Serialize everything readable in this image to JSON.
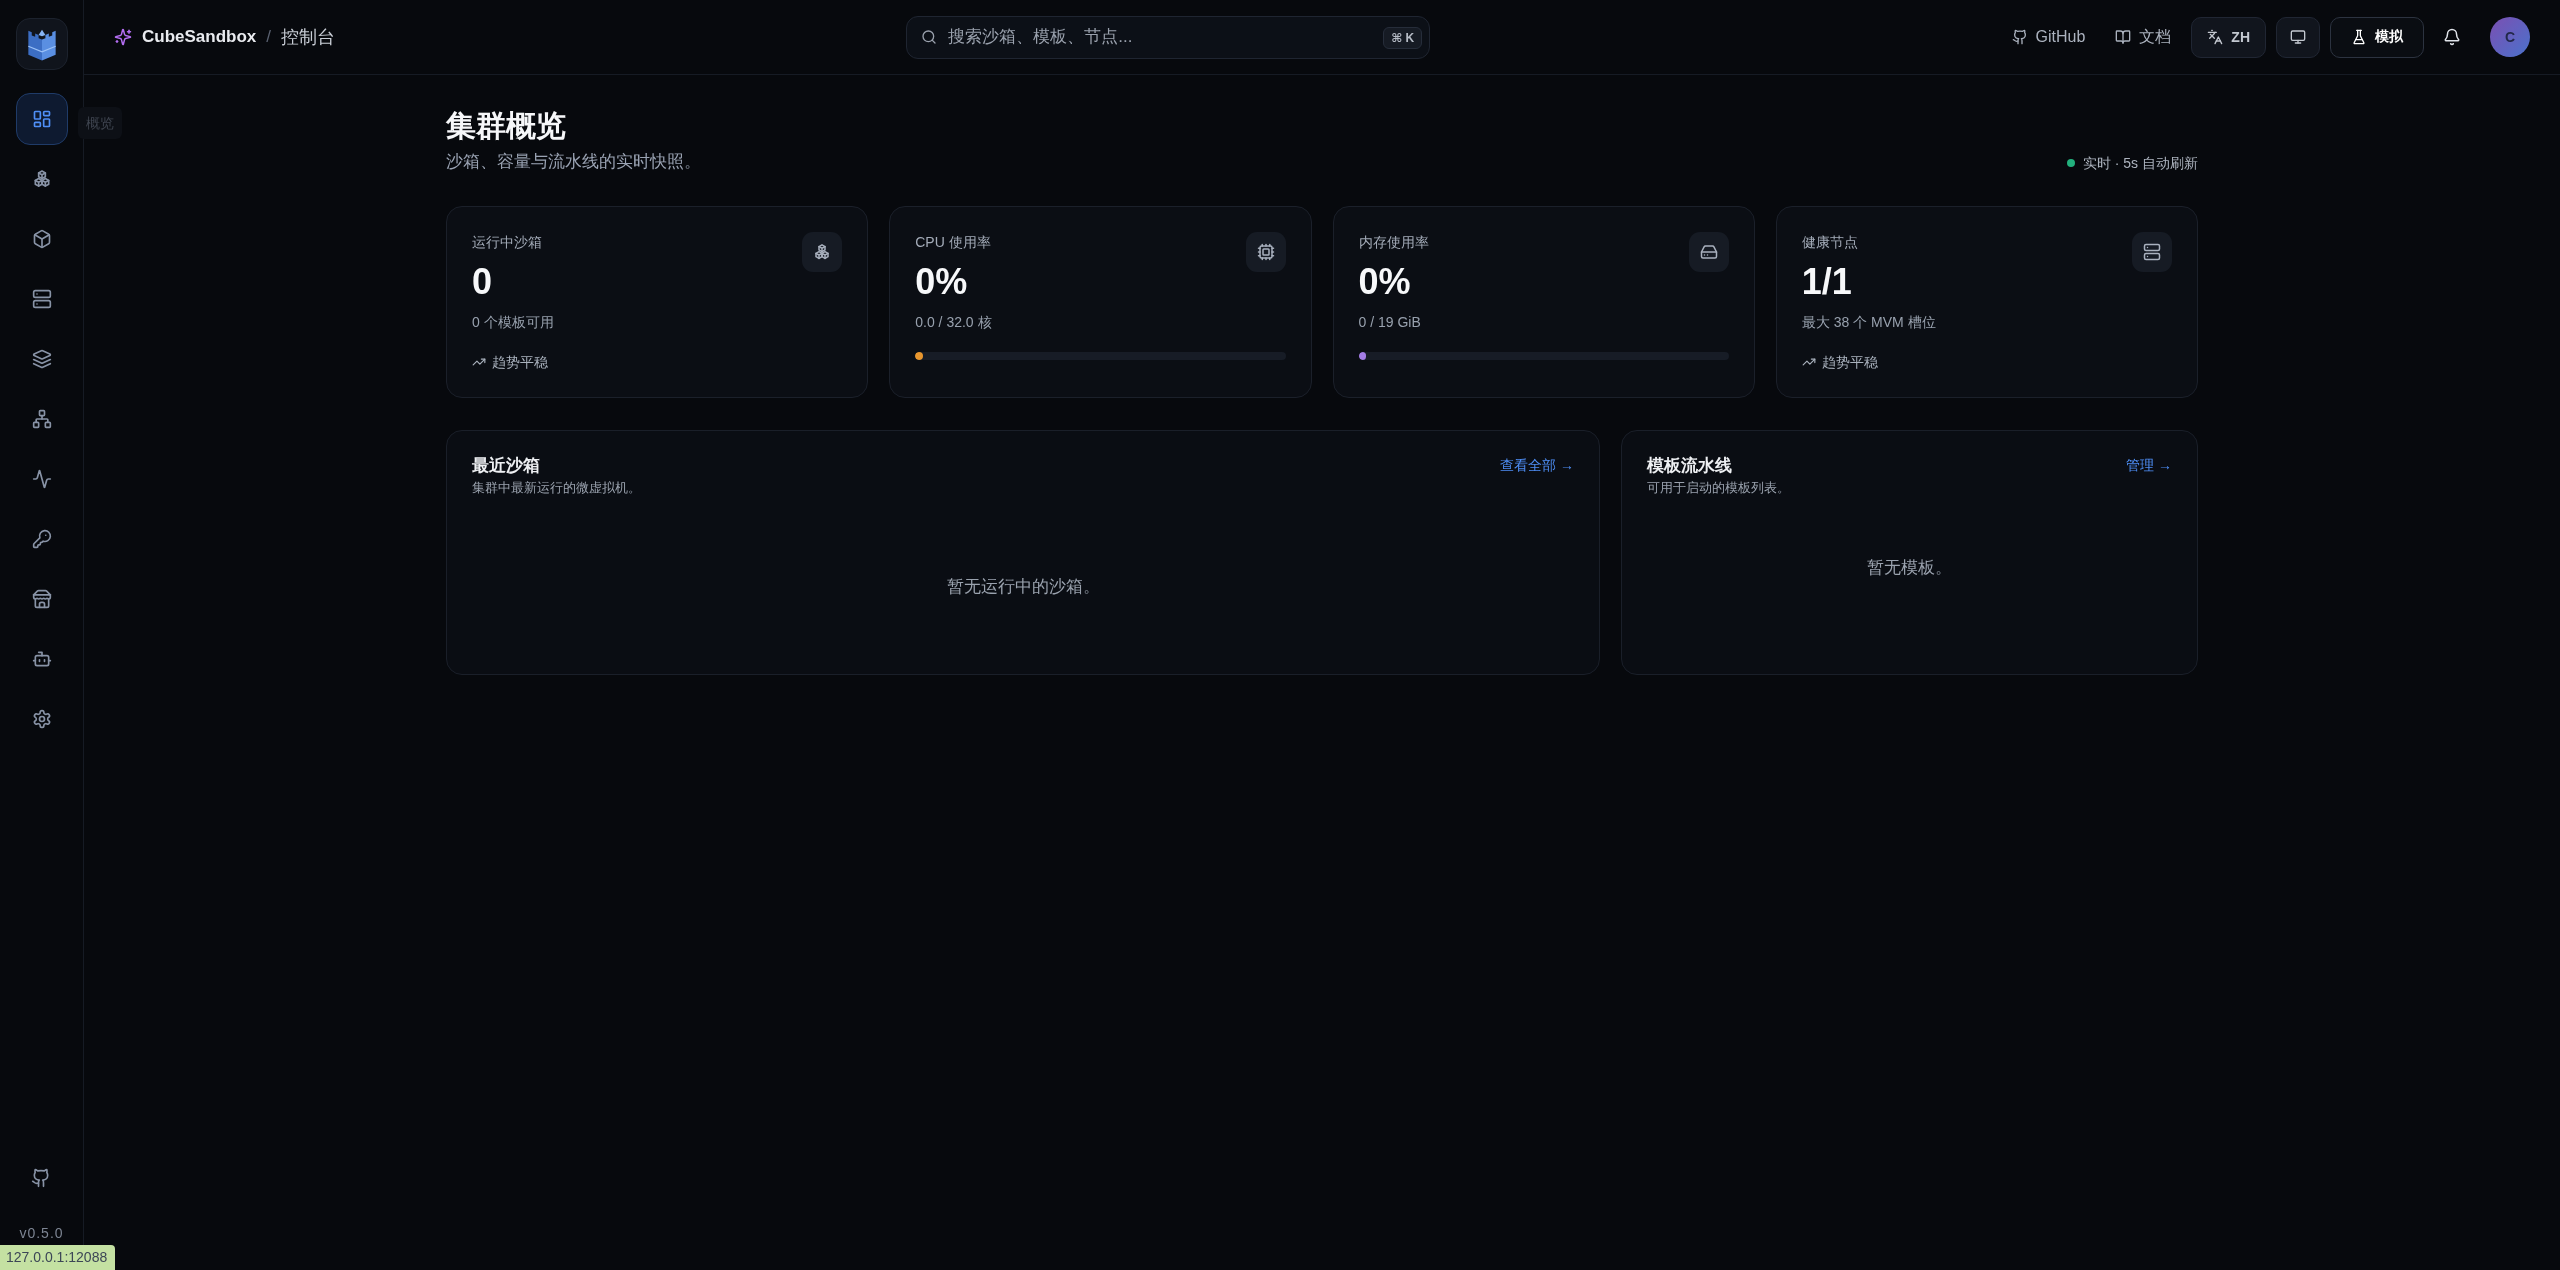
{
  "sidebar": {
    "items": [
      {
        "selected": true
      },
      {
        "selected": false
      },
      {
        "selected": false
      },
      {
        "selected": false
      },
      {
        "selected": false
      },
      {
        "selected": false
      },
      {
        "selected": false
      },
      {
        "selected": false
      },
      {
        "selected": false
      },
      {
        "selected": false
      },
      {
        "selected": false
      }
    ],
    "tooltip": "概览",
    "version": "v0.5.0"
  },
  "header": {
    "brand": "CubeSandbox",
    "separator": "/",
    "section": "控制台",
    "search": {
      "placeholder": "搜索沙箱、模板、节点...",
      "shortcut": "⌘ K"
    },
    "links": [
      {
        "label": "GitHub"
      },
      {
        "label": "文档"
      }
    ],
    "language": "ZH",
    "mode": "模拟",
    "avatar": "C"
  },
  "page": {
    "title": "集群概览",
    "subtitle": "沙箱、容量与流水线的实时快照。",
    "status": {
      "label": "实时 · 5s 自动刷新",
      "live": true
    }
  },
  "stats": [
    {
      "kind": "trend",
      "label": "运行中沙箱",
      "value": "0",
      "detail": "0 个模板可用",
      "trend": "趋势平稳"
    },
    {
      "kind": "bar",
      "label": "CPU 使用率",
      "value": "0%",
      "detail": "0.0 / 32.0 核",
      "level": 0.02,
      "color": "#e8962e"
    },
    {
      "kind": "bar",
      "label": "内存使用率",
      "value": "0%",
      "detail": "0 / 19 GiB",
      "level": 0.02,
      "color": "#a47de6"
    },
    {
      "kind": "trend",
      "label": "健康节点",
      "value": "1/1",
      "detail": "最大 38 个 MVM 槽位",
      "trend": "趋势平稳"
    }
  ],
  "panels": [
    {
      "title": "最近沙箱",
      "subtitle": "集群中最新运行的微虚拟机。",
      "link": "查看全部 →",
      "empty": "暂无运行中的沙箱。"
    },
    {
      "title": "模板流水线",
      "subtitle": "可用于启动的模板列表。",
      "link": "管理 →",
      "empty": "暂无模板。"
    }
  ],
  "status_bar": {
    "url": "127.0.0.1:12088"
  }
}
